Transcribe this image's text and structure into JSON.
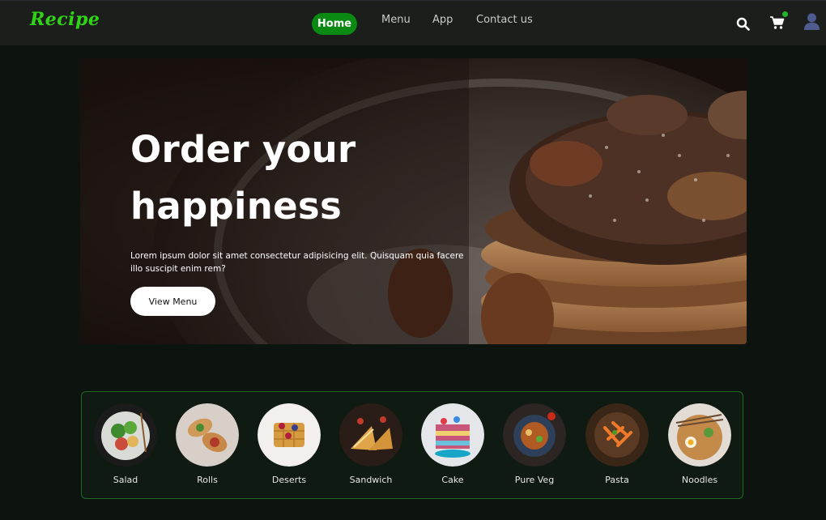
{
  "brand": {
    "name": "Recipe",
    "color": "#2fd417"
  },
  "nav": {
    "items": [
      {
        "label": "Home",
        "active": true
      },
      {
        "label": "Menu",
        "active": false
      },
      {
        "label": "App",
        "active": false
      },
      {
        "label": "Contact us",
        "active": false
      }
    ],
    "icons": [
      "search-icon",
      "cart-icon",
      "user-avatar-icon"
    ],
    "cart_badge_color": "#21b62a"
  },
  "hero": {
    "title": "Order your happiness",
    "text": "Lorem ipsum dolor sit amet consectetur adipisicing elit. Quisquam quia facere illo suscipit enim rem?",
    "button_label": "View Menu"
  },
  "categories": [
    {
      "label": "Salad"
    },
    {
      "label": "Rolls"
    },
    {
      "label": "Deserts"
    },
    {
      "label": "Sandwich"
    },
    {
      "label": "Cake"
    },
    {
      "label": "Pure Veg"
    },
    {
      "label": "Pasta"
    },
    {
      "label": "Noodles"
    }
  ],
  "colors": {
    "accent": "#0a8a12",
    "background": "#0d140f",
    "topbar": "#1c1e1c"
  }
}
